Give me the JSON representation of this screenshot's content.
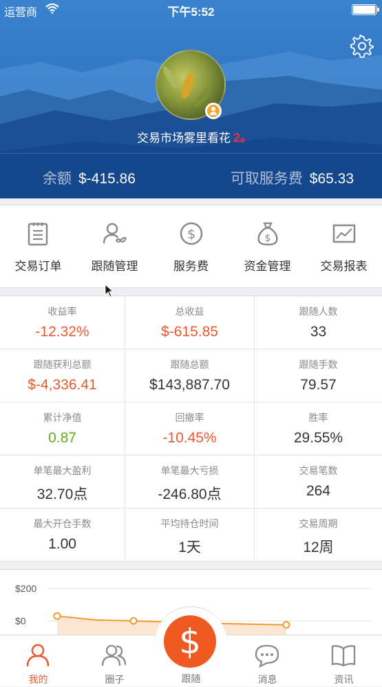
{
  "status_bar": {
    "carrier": "运营商",
    "time": "下午5:52"
  },
  "profile": {
    "username": "交易市场雾里看花",
    "level": "2",
    "level_suffix": "级"
  },
  "account": {
    "balance_label": "余额",
    "balance_value": "$-415.86",
    "fee_label": "可取服务费",
    "fee_value": "$65.33"
  },
  "menu": [
    {
      "label": "交易订单",
      "icon": "clipboard-icon"
    },
    {
      "label": "跟随管理",
      "icon": "users-infinity-icon"
    },
    {
      "label": "服务费",
      "icon": "dollar-circle-icon"
    },
    {
      "label": "资金管理",
      "icon": "money-bag-icon"
    },
    {
      "label": "交易报表",
      "icon": "line-chart-icon"
    }
  ],
  "stats": [
    {
      "label": "收益率",
      "value": "-12.32%",
      "color": "red"
    },
    {
      "label": "总收益",
      "value": "$-615.85",
      "color": "red"
    },
    {
      "label": "跟随人数",
      "value": "33",
      "color": "normal"
    },
    {
      "label": "跟随获利总额",
      "value": "$-4,336.41",
      "color": "red"
    },
    {
      "label": "跟随总额",
      "value": "$143,887.70",
      "color": "normal"
    },
    {
      "label": "跟随手数",
      "value": "79.57",
      "color": "normal"
    },
    {
      "label": "累计净值",
      "value": "0.87",
      "color": "green"
    },
    {
      "label": "回撤率",
      "value": "-10.45%",
      "color": "red"
    },
    {
      "label": "胜率",
      "value": "29.55%",
      "color": "normal"
    },
    {
      "label": "单笔最大盈利",
      "value": "32.70点",
      "color": "normal"
    },
    {
      "label": "单笔最大亏损",
      "value": "-246.80点",
      "color": "normal"
    },
    {
      "label": "交易笔数",
      "value": "264",
      "color": "normal"
    },
    {
      "label": "最大开仓手数",
      "value": "1.00",
      "color": "normal"
    },
    {
      "label": "平均持仓时间",
      "value": "1天",
      "color": "normal"
    },
    {
      "label": "交易周期",
      "value": "12周",
      "color": "normal"
    }
  ],
  "chart_data": {
    "type": "line",
    "y_ticks": [
      "$200",
      "$0"
    ],
    "ylim": [
      -50,
      230
    ],
    "values": [
      30,
      5,
      0,
      -15,
      -25
    ],
    "color": "#f29b2c"
  },
  "tabbar": {
    "tabs": [
      {
        "label": "我的",
        "icon": "person-icon",
        "active": true
      },
      {
        "label": "圈子",
        "icon": "group-icon",
        "active": false
      },
      {
        "label": "跟随",
        "icon": "dollar-icon",
        "active": false
      },
      {
        "label": "消息",
        "icon": "chat-bubble-icon",
        "active": false
      },
      {
        "label": "资讯",
        "icon": "book-icon",
        "active": false
      }
    ],
    "center_symbol": "$"
  },
  "colors": {
    "accent": "#ea5a2d",
    "positive": "#62ab1e",
    "hero": "#2f74c0"
  }
}
